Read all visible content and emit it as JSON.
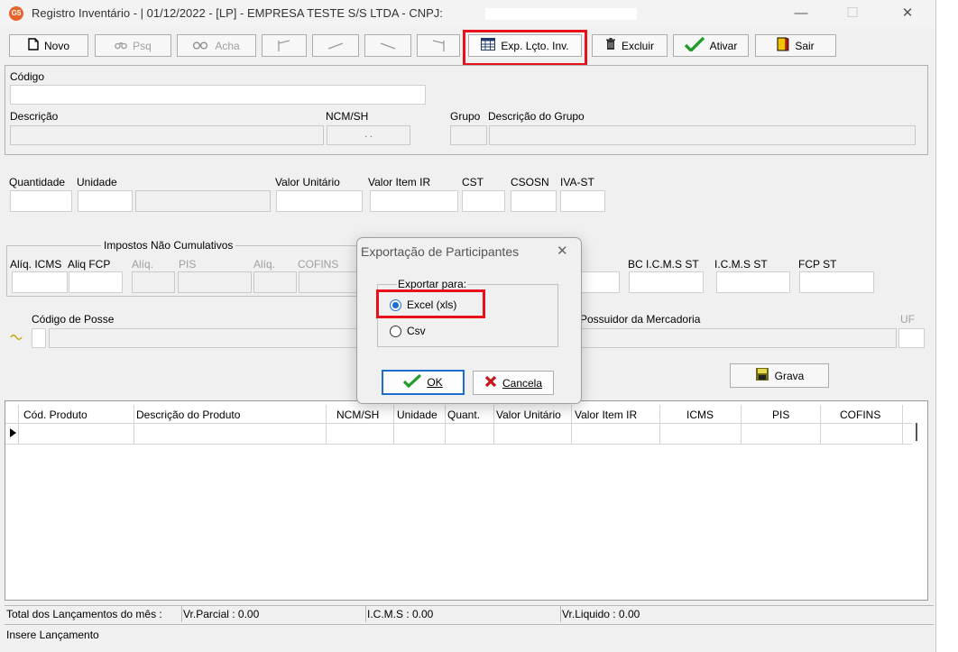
{
  "window": {
    "title": "Registro Inventário - |  01/12/2022 - [LP] - EMPRESA TESTE S/S LTDA - CNPJ: ",
    "app_icon_text": "G5",
    "minimize": "—",
    "maximize": "☐",
    "close": "✕"
  },
  "toolbar": {
    "novo": "Novo",
    "psq": "Psq",
    "acha": "Acha",
    "first": "|<",
    "prev": "<",
    "next": ">",
    "last": ">|",
    "exp": "Exp. Lçto. Inv.",
    "excluir": "Excluir",
    "ativar": "Ativar",
    "sair": "Sair"
  },
  "form": {
    "codigo": "Código",
    "descricao": "Descrição",
    "ncm": "NCM/SH",
    "ncm_value": ". .",
    "grupo": "Grupo",
    "desc_grupo": "Descrição do Grupo",
    "quantidade": "Quantidade",
    "unidade": "Unidade",
    "valor_unitario": "Valor Unitário",
    "valor_item_ir": "Valor Item IR",
    "cst": "CST",
    "csosn": "CSOSN",
    "iva_st": "IVA-ST",
    "impostos_title": "Impostos Não Cumulativos",
    "aliq_icms": "Alíq. ICMS",
    "aliq_fcp": "Aliq FCP",
    "aliq1": "Alíq.",
    "pis": "PIS",
    "aliq2": "Alíq.",
    "cofins": "COFINS",
    "bc_icms_st": "BC I.C.M.S ST",
    "icms_st": "I.C.M.S ST",
    "fcp_st": "FCP ST",
    "codigo_posse": "Código de Posse",
    "possuidor": "Possuidor da Mercadoria",
    "uf": "UF",
    "grava": "Grava"
  },
  "grid": {
    "columns": [
      "Cód. Produto",
      "Descrição do Produto",
      "NCM/SH",
      "Unidade",
      "Quant.",
      "Valor Unitário",
      "Valor Item IR",
      "ICMS",
      "PIS",
      "COFINS"
    ]
  },
  "status": {
    "total": "Total dos Lançamentos do mês :",
    "parcial": "Vr.Parcial : 0.00",
    "icms": "I.C.M.S : 0.00",
    "liquido": "Vr.Liquido : 0.00",
    "message": "Insere Lançamento"
  },
  "dialog": {
    "title": "Exportação de Participantes",
    "close": "✕",
    "group_label": "Exportar para:",
    "option_excel": "Excel (xls)",
    "option_csv": "Csv",
    "selected": "Excel (xls)",
    "ok": "OK",
    "cancel": "Cancela"
  },
  "colors": {
    "highlight": "#e8101a",
    "ok_check": "#1f9c2a",
    "cancel_x": "#c4161c",
    "focus": "#1c6fd1"
  }
}
